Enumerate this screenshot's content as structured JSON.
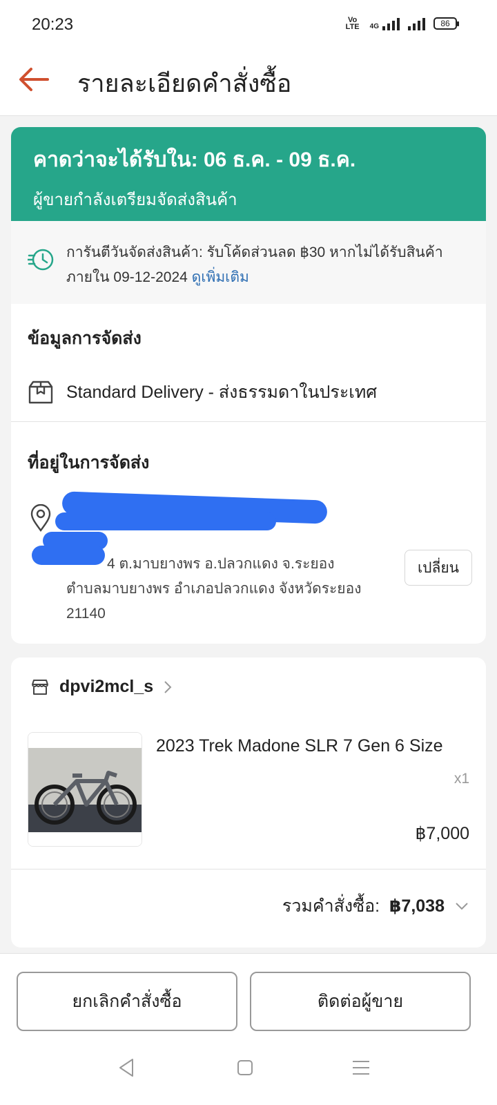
{
  "status_bar": {
    "time": "20:23",
    "volte": "Vo LTE",
    "network": "4G",
    "battery": "86"
  },
  "header": {
    "title": "รายละเอียดคำสั่งซื้อ",
    "back_icon": "arrow-left-icon"
  },
  "delivery_banner": {
    "eta": "คาดว่าจะได้รับใน: 06 ธ.ค. - 09 ธ.ค.",
    "status": "ผู้ขายกำลังเตรียมจัดส่งสินค้า"
  },
  "guarantee": {
    "text": "การันตีวันจัดส่งสินค้า: รับโค้ดส่วนลด ฿30 หากไม่ได้รับสินค้าภายใน 09-12-2024",
    "link": "ดูเพิ่มเติม"
  },
  "shipping_info": {
    "title": "ข้อมูลการจัดส่ง",
    "method": "Standard Delivery - ส่งธรรมดาในประเทศ"
  },
  "address": {
    "title": "ที่อยู่ในการจัดส่ง",
    "line_partial": "4  ต.มาบยางพร อ.ปลวกแดง จ.ระยอง",
    "line_full": "ตำบลมาบยางพร อำเภอปลวกแดง จังหวัดระยอง 21140",
    "change_label": "เปลี่ยน"
  },
  "order": {
    "shop_name": "dpvi2mcl_s",
    "product_name": "2023 Trek Madone SLR 7 Gen 6 Size",
    "quantity": "x1",
    "price": "฿7,000",
    "total_label": "รวมคำสั่งซื้อ:",
    "total_value": "฿7,038"
  },
  "actions": {
    "cancel_label": "ยกเลิกคำสั่งซื้อ",
    "contact_label": "ติดต่อผู้ขาย"
  },
  "colors": {
    "brand_red": "#d0502f",
    "banner_green": "#26a68a",
    "link_blue": "#2f6fb3",
    "redaction_blue": "#2f6ff2"
  }
}
